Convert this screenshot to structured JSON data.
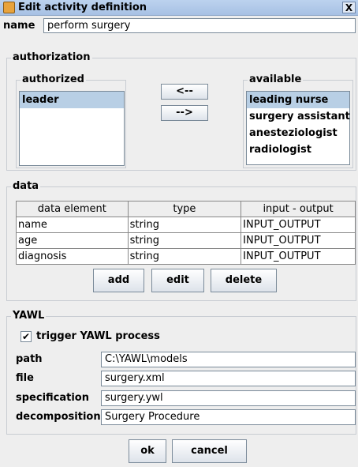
{
  "window": {
    "title": "Edit activity definition",
    "close_label": "X"
  },
  "name_label": "name",
  "name_value": "perform surgery",
  "authorization": {
    "legend": "authorization",
    "authorized_legend": "authorized",
    "authorized_items": [
      "leader"
    ],
    "available_legend": "available",
    "available_items": [
      "leading nurse",
      "surgery assistant",
      "anesteziologist",
      "radiologist"
    ],
    "move_left_label": "<--",
    "move_right_label": "-->"
  },
  "data": {
    "legend": "data",
    "columns": [
      "data element",
      "type",
      "input - output"
    ],
    "rows": [
      [
        "name",
        "string",
        "INPUT_OUTPUT"
      ],
      [
        "age",
        "string",
        "INPUT_OUTPUT"
      ],
      [
        "diagnosis",
        "string",
        "INPUT_OUTPUT"
      ]
    ],
    "add_label": "add",
    "edit_label": "edit",
    "delete_label": "delete"
  },
  "yawl": {
    "legend": "YAWL",
    "trigger_label": "trigger YAWL process",
    "trigger_checked": true,
    "path_label": "path",
    "path_value": "C:\\YAWL\\models",
    "file_label": "file",
    "file_value": "surgery.xml",
    "spec_label": "specification",
    "spec_value": "surgery.ywl",
    "decomp_label": "decomposition",
    "decomp_value": "Surgery Procedure"
  },
  "buttons": {
    "ok_label": "ok",
    "cancel_label": "cancel"
  }
}
